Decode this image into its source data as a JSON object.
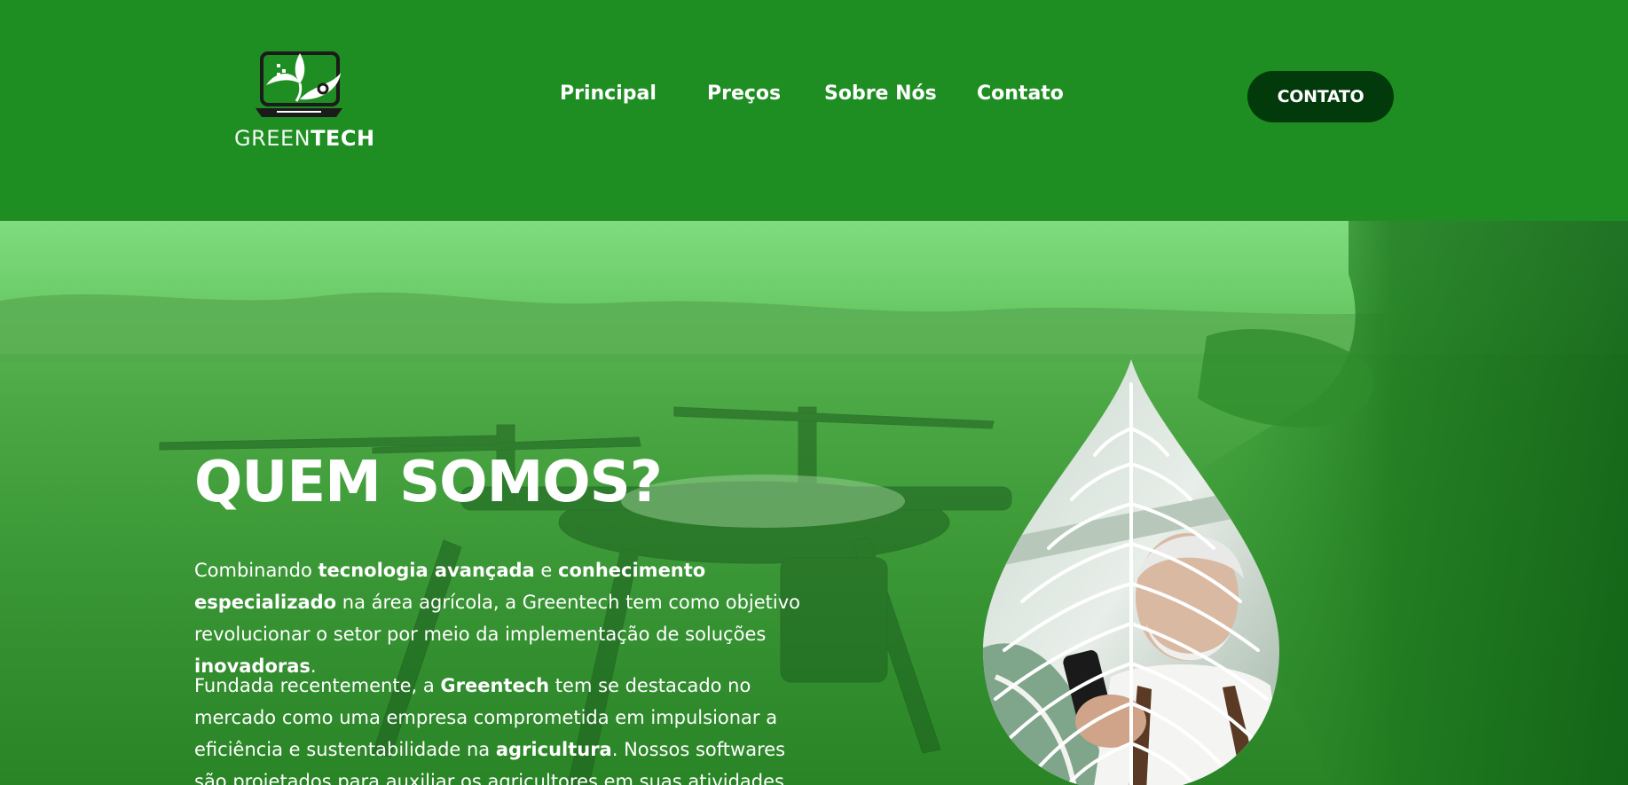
{
  "brand": {
    "name_light": "GREEN",
    "name_bold": "TECH"
  },
  "nav": {
    "items": [
      "Principal",
      "Preços",
      "Sobre Nós",
      "Contato"
    ]
  },
  "cta": {
    "label": "CONTATO"
  },
  "hero": {
    "title": "QUEM SOMOS?",
    "p1": [
      {
        "t": "Combinando ",
        "b": false
      },
      {
        "t": "tecnologia avançada",
        "b": true
      },
      {
        "t": " e ",
        "b": false
      },
      {
        "t": "conhecimento especializado",
        "b": true
      },
      {
        "t": " na área agrícola, a Greentech tem como objetivo revolucionar o setor por meio da implementação de soluções ",
        "b": false
      },
      {
        "t": "inovadoras",
        "b": true
      },
      {
        "t": ".",
        "b": false
      }
    ],
    "p2": [
      {
        "t": "Fundada recentemente, a ",
        "b": false
      },
      {
        "t": "Greentech",
        "b": true
      },
      {
        "t": " tem se destacado no mercado como uma empresa comprometida em impulsionar a eficiência e sustentabilidade na ",
        "b": false
      },
      {
        "t": "agricultura",
        "b": true
      },
      {
        "t": ". Nossos softwares são projetados para auxiliar os agricultores em suas atividades",
        "b": false
      }
    ]
  },
  "colors": {
    "header_bg": "#1e8e22",
    "cta_bg": "#033a0b",
    "text": "#ffffff"
  },
  "icons": [
    "laptop-leaf-logo-icon",
    "leaf-drop-image"
  ]
}
